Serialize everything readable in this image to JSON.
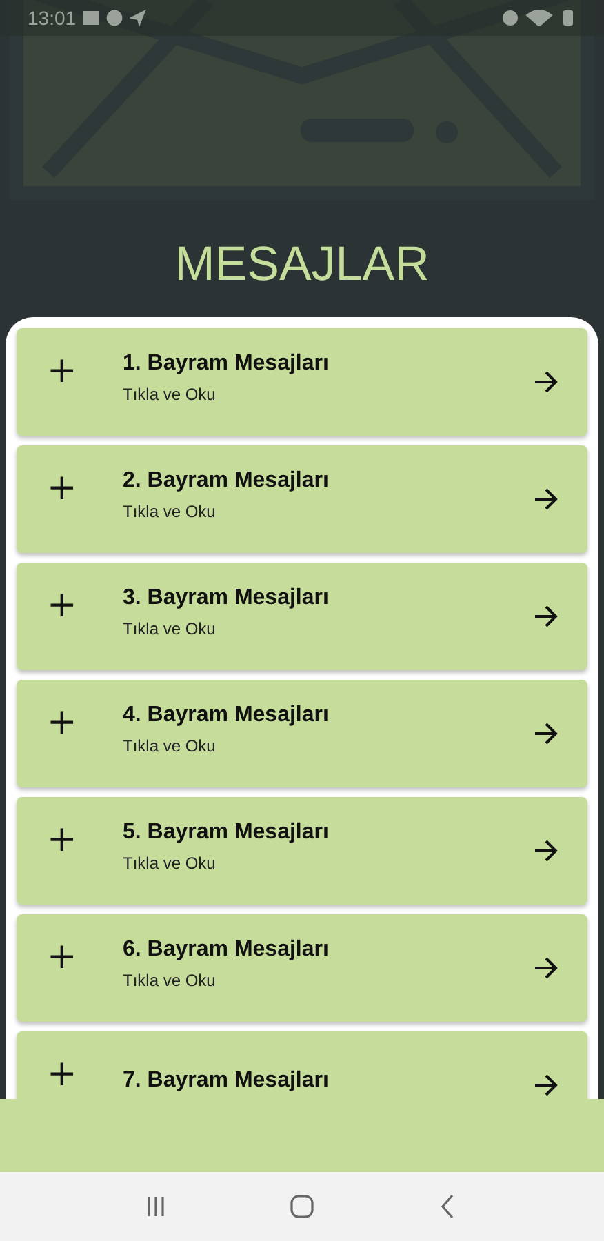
{
  "status_bar": {
    "time": "13:01"
  },
  "header": {
    "title": "MESAJLAR"
  },
  "items": [
    {
      "icon": "+",
      "title": "1. Bayram Mesajları",
      "subtitle": "Tıkla ve Oku"
    },
    {
      "icon": "+",
      "title": "2. Bayram Mesajları",
      "subtitle": "Tıkla ve Oku"
    },
    {
      "icon": "+",
      "title": "3. Bayram Mesajları",
      "subtitle": "Tıkla ve Oku"
    },
    {
      "icon": "+",
      "title": "4. Bayram Mesajları",
      "subtitle": "Tıkla ve Oku"
    },
    {
      "icon": "+",
      "title": "5. Bayram Mesajları",
      "subtitle": "Tıkla ve Oku"
    },
    {
      "icon": "+",
      "title": "6. Bayram Mesajları",
      "subtitle": "Tıkla ve Oku"
    },
    {
      "icon": "+",
      "title": "7. Bayram Mesajları"
    }
  ]
}
